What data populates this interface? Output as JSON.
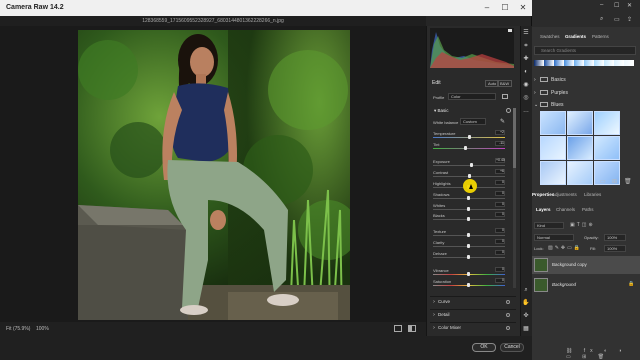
{
  "titlebar": {
    "title": "Camera Raw 14.2"
  },
  "filebar": {
    "filename": "128368559_1715609552328927_6803144801362228266_n.jpg"
  },
  "bottom": {
    "zoom_select": "Fit (75.9%)",
    "zoom_100": "100%"
  },
  "footer": {
    "ok_label": "OK",
    "cancel_label": "Cancel"
  },
  "panel": {
    "edit_title": "Edit",
    "auto_label": "Auto",
    "bw_label": "B&W",
    "profile_label": "Profile",
    "profile_value": "Color",
    "basic_title": "Basic",
    "white_balance_label": "White balance",
    "white_balance_value": "Custom",
    "sliders": [
      {
        "label": "Temperature",
        "value": "+2",
        "position": 0.52
      },
      {
        "label": "Tint",
        "value": "-11",
        "position": 0.46
      },
      {
        "label": "Exposure",
        "value": "+0.40",
        "position": 0.55
      },
      {
        "label": "Contrast",
        "value": "+6",
        "position": 0.52
      },
      {
        "label": "Highlights",
        "value": "0",
        "position": 0.5
      },
      {
        "label": "Shadows",
        "value": "0",
        "position": 0.5
      },
      {
        "label": "Whites",
        "value": "0",
        "position": 0.5
      },
      {
        "label": "Blacks",
        "value": "0",
        "position": 0.5
      },
      {
        "label": "Texture",
        "value": "0",
        "position": 0.5
      },
      {
        "label": "Clarity",
        "value": "0",
        "position": 0.5
      },
      {
        "label": "Dehaze",
        "value": "0",
        "position": 0.5
      },
      {
        "label": "Vibrance",
        "value": "0",
        "position": 0.5
      },
      {
        "label": "Saturation",
        "value": "0",
        "position": 0.5
      }
    ],
    "sections": [
      "Curve",
      "Detail",
      "Color Mixer"
    ]
  },
  "ps": {
    "top_tabs": [
      "Swatches",
      "Gradients",
      "Patterns"
    ],
    "search_placeholder": "Search Gradients",
    "groups": [
      "Basics",
      "Purples",
      "Blues"
    ],
    "layer_tabs": [
      "Properties",
      "Adjustments",
      "Libraries"
    ],
    "layer_subtabs": [
      "Layers",
      "Channels",
      "Paths"
    ],
    "kind_label": "Kind",
    "mode_label": "Normal",
    "opacity_label": "Opacity:",
    "opacity_value": "100%",
    "lock_label": "Lock:",
    "fill_label": "Fill:",
    "fill_value": "100%",
    "layers": [
      {
        "name": "Background copy"
      },
      {
        "name": "Background"
      }
    ]
  }
}
